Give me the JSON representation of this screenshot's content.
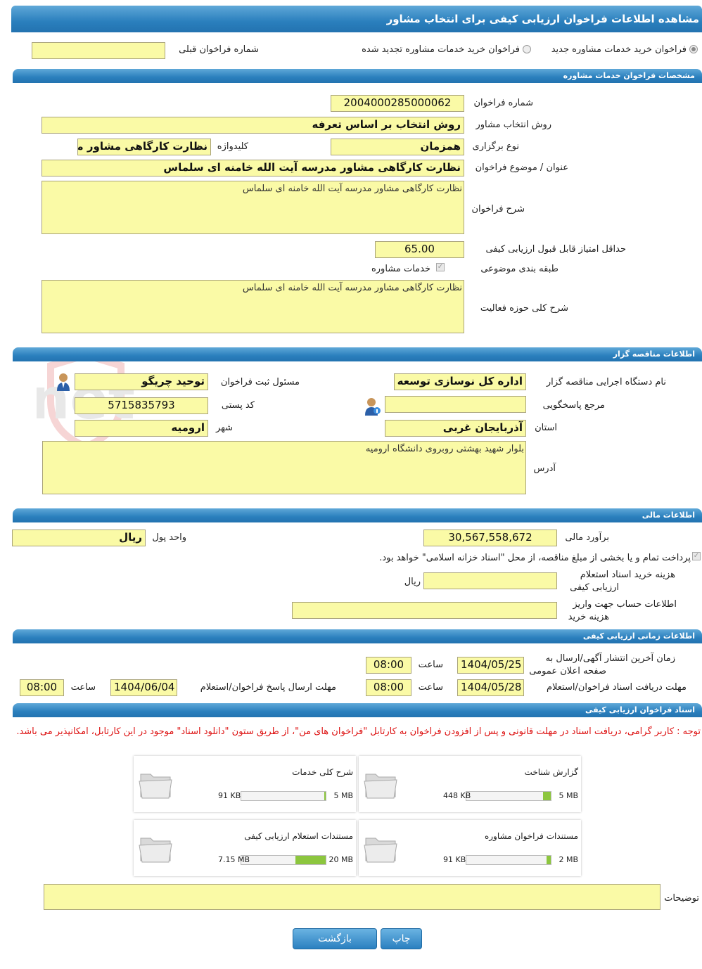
{
  "page_title": "مشاهده اطلاعات فراخوان ارزیابی کیفی برای انتخاب مشاور",
  "top": {
    "radio_new": "فراخوان خرید خدمات مشاوره جدید",
    "radio_renew": "فراخوان خرید خدمات مشاوره تجدید شده",
    "prev_call_label": "شماره فراخوان قبلی",
    "prev_call_value": ""
  },
  "sections": {
    "consult": "مشخصات فراخوان خدمات مشاوره",
    "tender": "اطلاعات مناقصه گزار",
    "finance": "اطلاعات مالی",
    "timing": "اطلاعات زمانی ارزیابی کیفی",
    "docs": "اسناد فراخوان ارزیابی کیفی"
  },
  "consult": {
    "call_no_label": "شماره فراخوان",
    "call_no": "2004000285000062",
    "method_label": "روش انتخاب مشاور",
    "method": "روش انتخاب بر اساس تعرفه",
    "type_label": "نوع برگزاری",
    "type": "همزمان",
    "keyword_label": "کلیدواژه",
    "keyword": "نظارت کارگاهی مشاور  مدر",
    "subject_label": "عنوان / موضوع فراخوان",
    "subject": "نظارت کارگاهی مشاور  مدرسه آیت الله خامنه ای سلماس",
    "desc_label": "شرح فراخوان",
    "desc": "نظارت کارگاهی مشاور  مدرسه آیت الله خامنه ای سلماس",
    "min_score_label": "حداقل امتیاز قابل قبول ارزیابی کیفی",
    "min_score": "65.00",
    "category_label": "طبقه بندی موضوعی",
    "category_value": "خدمات مشاوره",
    "scope_label": "شرح کلی حوزه فعالیت",
    "scope": "نظارت کارگاهی مشاور  مدرسه آیت الله خامنه ای سلماس"
  },
  "tender": {
    "org_label": "نام دستگاه اجرایی مناقصه گزار",
    "org": "اداره کل نوسازی   توسعه و",
    "registrar_label": "مسئول ثبت فراخوان",
    "registrar": "توحید چریگو",
    "ref_label": "مرجع پاسخگویی",
    "ref": "",
    "postal_label": "کد پستی",
    "postal": "5715835793",
    "province_label": "استان",
    "province": "آذربایجان غربی",
    "city_label": "شهر",
    "city": "ارومیه",
    "address_label": "آدرس",
    "address": "بلوار شهید بهشتی روبروی دانشگاه ارومیه"
  },
  "finance": {
    "estimate_label": "برآورد مالی",
    "estimate": "30,567,558,672",
    "currency_label": "واحد پول",
    "currency": "ریال",
    "treasury_note": "پرداخت تمام و یا بخشی از مبلغ مناقصه، از محل \"اسناد خزانه اسلامی\" خواهد بود.",
    "doc_fee_label_1": "هزینه خرید اسناد استعلام",
    "doc_fee_label_2": "ارزیابی کیفی",
    "doc_fee": "",
    "doc_fee_unit": "ریال",
    "account_label_1": "اطلاعات حساب جهت واریز",
    "account_label_2": "هزینه خرید",
    "account": ""
  },
  "timing": {
    "publish_label_1": "زمان آخرین انتشار آگهی/ارسال به",
    "publish_label_2": "صفحه اعلان عمومی",
    "publish_date": "1404/05/25",
    "publish_time": "08:00",
    "time_label": "ساعت",
    "receive_label": "مهلت دریافت اسناد فراخوان/استعلام",
    "receive_date": "1404/05/28",
    "receive_time": "08:00",
    "reply_label": "مهلت ارسال پاسخ فراخوان/استعلام",
    "reply_date": "1404/06/04",
    "reply_time": "08:00"
  },
  "notice": "توجه : کاربر گرامی، دریافت اسناد در مهلت قانونی و پس از افزودن فراخوان به کارتابل \"فراخوان های من\"، از طریق ستون \"دانلود اسناد\" موجود در این کارتابل، امکانپذیر می باشد.",
  "documents": [
    {
      "title": "گزارش شناخت",
      "size": "448 KB",
      "max": "5 MB",
      "ratio": 0.09
    },
    {
      "title": "شرح کلی خدمات",
      "size": "91 KB",
      "max": "5 MB",
      "ratio": 0.02
    },
    {
      "title": "مستندات فراخوان مشاوره",
      "size": "91 KB",
      "max": "2 MB",
      "ratio": 0.05
    },
    {
      "title": "مستندات استعلام ارزیابی کیفی",
      "size": "7.15 MB",
      "max": "20 MB",
      "ratio": 0.36
    }
  ],
  "notes_label": "توضیحات",
  "notes": "",
  "buttons": {
    "print": "چاپ",
    "back": "بازگشت"
  },
  "watermark": "AriaTender.net",
  "colors": {
    "header": "#2a7fbd",
    "field": "#fafaa6",
    "bar": "#8cc63e",
    "notice": "#dd1111"
  }
}
